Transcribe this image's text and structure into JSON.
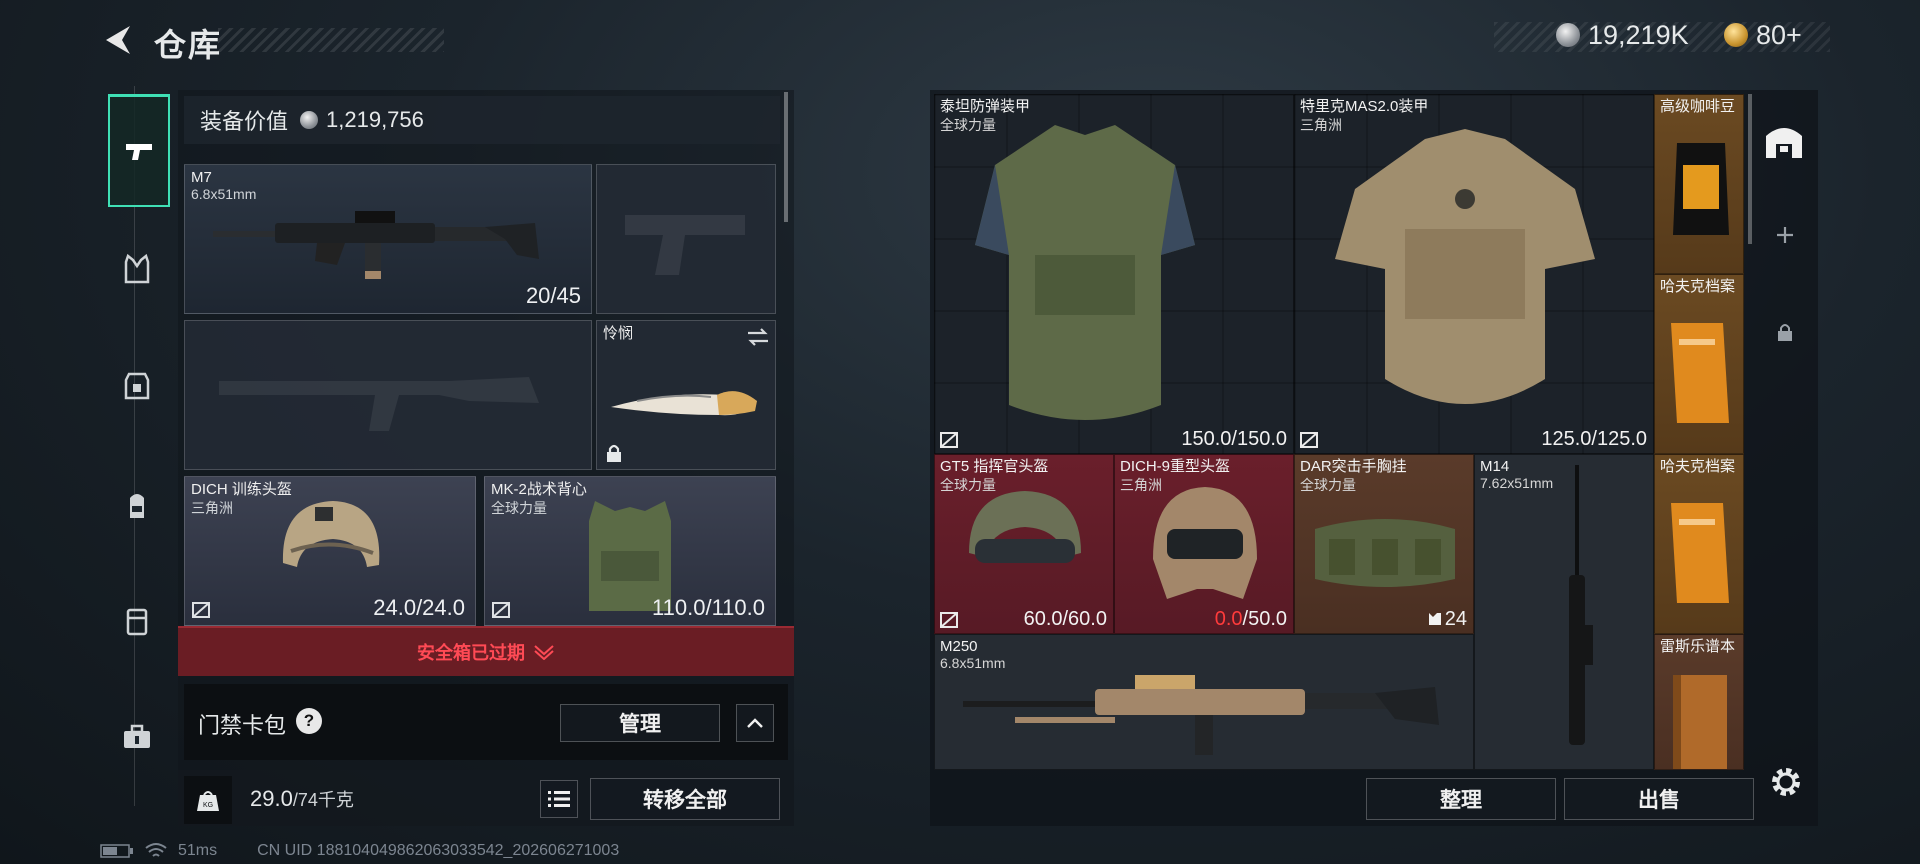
{
  "header": {
    "title": "仓库"
  },
  "currency": {
    "silver": "19,219K",
    "gold": "80+"
  },
  "equipment": {
    "value_label": "装备价值",
    "value": "1,219,756",
    "primary_weapon": {
      "name": "M7",
      "caliber": "6.8x51mm",
      "ammo": "20/45"
    },
    "melee": {
      "name": "怜悯"
    },
    "helmet": {
      "name": "DICH 训练头盔",
      "map": "三角洲",
      "durability": "24.0/24.0"
    },
    "armor": {
      "name": "MK-2战术背心",
      "map": "全球力量",
      "durability": "110.0/110.0"
    }
  },
  "safebox": {
    "expired_label": "安全箱已过期"
  },
  "keycard": {
    "label": "门禁卡包",
    "help": "?",
    "manage_label": "管理"
  },
  "weight": {
    "current": "29.0",
    "max": "/74千克",
    "transfer_label": "转移全部"
  },
  "warehouse": {
    "items": [
      {
        "name": "泰坦防弹装甲",
        "sub": "全球力量",
        "value": "150.0/150.0"
      },
      {
        "name": "特里克MAS2.0装甲",
        "sub": "三角洲",
        "value": "125.0/125.0"
      },
      {
        "name": "高级咖啡豆",
        "sub": "",
        "value": ""
      },
      {
        "name": "哈夫克档案",
        "sub": "",
        "value": ""
      },
      {
        "name": "GT5 指挥官头盔",
        "sub": "全球力量",
        "value": "60.0/60.0"
      },
      {
        "name": "DICH-9重型头盔",
        "sub": "三角洲",
        "value_red": "0.0",
        "value_rest": "/50.0"
      },
      {
        "name": "DAR突击手胸挂",
        "sub": "全球力量",
        "value": "24"
      },
      {
        "name": "M14",
        "sub": "7.62x51mm",
        "value": ""
      },
      {
        "name": "哈夫克档案",
        "sub": "",
        "value": ""
      },
      {
        "name": "M250",
        "sub": "6.8x51mm",
        "value": ""
      },
      {
        "name": "雷斯乐谱本",
        "sub": "",
        "value": ""
      }
    ],
    "sort_label": "整理",
    "sell_label": "出售"
  },
  "status": {
    "ping": "51ms",
    "uid": "CN UID 1881040498620630335​42_202606271003"
  },
  "colors": {
    "accent": "#3fe0b5",
    "danger": "#ff4a55",
    "red_cell": "#6a1f2b"
  }
}
